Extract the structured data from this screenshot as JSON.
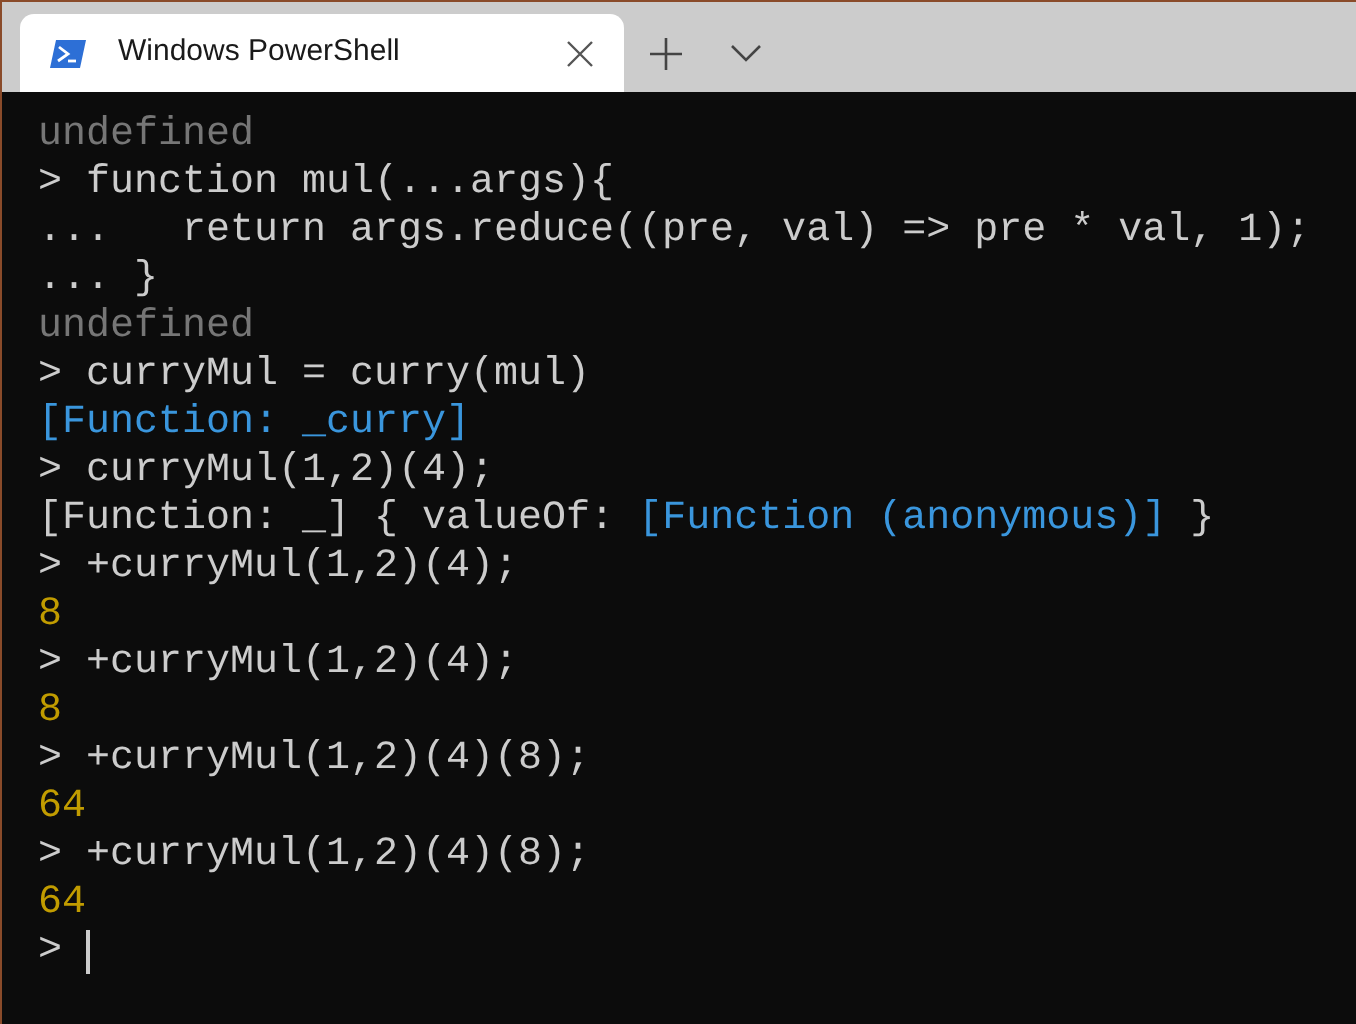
{
  "tab": {
    "title": "Windows PowerShell",
    "selected": true
  },
  "terminal": {
    "lines": [
      [
        {
          "text": "undefined",
          "kind": "dim"
        }
      ],
      [
        {
          "text": "> function mul(...args){",
          "kind": "plain"
        }
      ],
      [
        {
          "text": "...   return args.reduce((pre, val) => pre * val, 1);",
          "kind": "plain"
        }
      ],
      [
        {
          "text": "... }",
          "kind": "plain"
        }
      ],
      [
        {
          "text": "undefined",
          "kind": "dim"
        }
      ],
      [
        {
          "text": "> curryMul = curry(mul)",
          "kind": "plain"
        }
      ],
      [
        {
          "text": "[Function: _curry]",
          "kind": "blue"
        }
      ],
      [
        {
          "text": "> curryMul(1,2)(4);",
          "kind": "plain"
        }
      ],
      [
        {
          "text": "[Function: _] { valueOf: ",
          "kind": "plain"
        },
        {
          "text": "[Function (anonymous)]",
          "kind": "blue"
        },
        {
          "text": " }",
          "kind": "plain"
        }
      ],
      [
        {
          "text": "> +curryMul(1,2)(4);",
          "kind": "plain"
        }
      ],
      [
        {
          "text": "8",
          "kind": "yellow"
        }
      ],
      [
        {
          "text": "> +curryMul(1,2)(4);",
          "kind": "plain"
        }
      ],
      [
        {
          "text": "8",
          "kind": "yellow"
        }
      ],
      [
        {
          "text": "> +curryMul(1,2)(4)(8);",
          "kind": "plain"
        }
      ],
      [
        {
          "text": "64",
          "kind": "yellow"
        }
      ],
      [
        {
          "text": "> +curryMul(1,2)(4)(8);",
          "kind": "plain"
        }
      ],
      [
        {
          "text": "64",
          "kind": "yellow"
        }
      ]
    ],
    "prompt": {
      "text": ">",
      "cursor": true
    }
  }
}
